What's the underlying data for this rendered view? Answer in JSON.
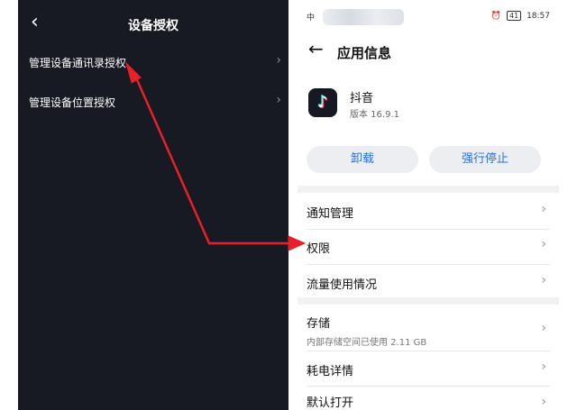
{
  "left_screen": {
    "back_icon": "chevron-left-icon",
    "title": "设备授权",
    "items": [
      {
        "label": "管理设备通讯录授权"
      },
      {
        "label": "管理设备位置授权"
      }
    ]
  },
  "right_screen": {
    "status_bar": {
      "carrier": "中",
      "battery": "41",
      "time": "18:57"
    },
    "header": {
      "title": "应用信息"
    },
    "app": {
      "name": "抖音",
      "version": "版本 16.9.1",
      "icon": "tiktok-icon"
    },
    "buttons": {
      "uninstall": "卸载",
      "force_stop": "强行停止"
    },
    "rows": [
      {
        "label": "通知管理"
      },
      {
        "label": "权限"
      },
      {
        "label": "流量使用情况"
      },
      {
        "label": "存储",
        "sub": "内部存储空间已使用 2.11 GB"
      },
      {
        "label": "耗电详情"
      },
      {
        "label": "默认打开"
      }
    ]
  },
  "colors": {
    "arrow": "#e8202a",
    "left_bg": "#171a22",
    "accent": "#2a6fe8"
  }
}
